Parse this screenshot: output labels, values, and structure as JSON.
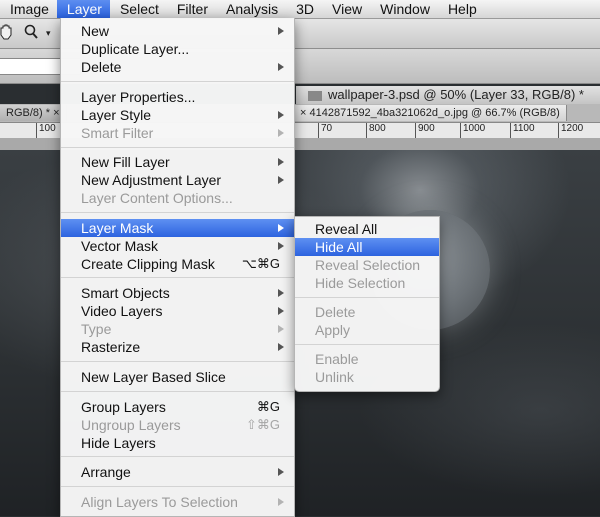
{
  "menubar": {
    "items": [
      {
        "label": "Image"
      },
      {
        "label": "Layer",
        "active": true
      },
      {
        "label": "Select"
      },
      {
        "label": "Filter"
      },
      {
        "label": "Analysis"
      },
      {
        "label": "3D"
      },
      {
        "label": "View"
      },
      {
        "label": "Window"
      },
      {
        "label": "Help"
      }
    ]
  },
  "toolbar": {
    "icons": [
      "hand-icon",
      "zoom-icon"
    ]
  },
  "document": {
    "title": "wallpaper-3.psd @ 50% (Layer 33, RGB/8) *"
  },
  "tabs": [
    {
      "label": "RGB/8) *",
      "close": "×"
    },
    {
      "label": "4142871592_4ba321062d_o.jpg @ 66.7% (RGB/8)",
      "close": "×"
    }
  ],
  "rulers": {
    "left": [
      "100"
    ],
    "right": [
      "70",
      "800",
      "900",
      "1000",
      "1100",
      "1200"
    ]
  },
  "layer_menu": {
    "items": [
      {
        "label": "New",
        "submenu": true
      },
      {
        "label": "Duplicate Layer..."
      },
      {
        "label": "Delete",
        "submenu": true
      },
      {
        "sep": true
      },
      {
        "label": "Layer Properties..."
      },
      {
        "label": "Layer Style",
        "submenu": true
      },
      {
        "label": "Smart Filter",
        "submenu": true,
        "disabled": true
      },
      {
        "sep": true
      },
      {
        "label": "New Fill Layer",
        "submenu": true
      },
      {
        "label": "New Adjustment Layer",
        "submenu": true
      },
      {
        "label": "Layer Content Options...",
        "disabled": true
      },
      {
        "sep": true
      },
      {
        "label": "Layer Mask",
        "submenu": true,
        "highlighted": true
      },
      {
        "label": "Vector Mask",
        "submenu": true
      },
      {
        "label": "Create Clipping Mask",
        "shortcut": "⌥⌘G"
      },
      {
        "sep": true
      },
      {
        "label": "Smart Objects",
        "submenu": true
      },
      {
        "label": "Video Layers",
        "submenu": true
      },
      {
        "label": "Type",
        "submenu": true,
        "disabled": true
      },
      {
        "label": "Rasterize",
        "submenu": true
      },
      {
        "sep": true
      },
      {
        "label": "New Layer Based Slice"
      },
      {
        "sep": true
      },
      {
        "label": "Group Layers",
        "shortcut": "⌘G"
      },
      {
        "label": "Ungroup Layers",
        "shortcut": "⇧⌘G",
        "disabled": true
      },
      {
        "label": "Hide Layers"
      },
      {
        "sep": true
      },
      {
        "label": "Arrange",
        "submenu": true
      },
      {
        "sep": true
      },
      {
        "label": "Align Layers To Selection",
        "submenu": true,
        "disabled": true
      }
    ]
  },
  "mask_menu": {
    "items": [
      {
        "label": "Reveal All"
      },
      {
        "label": "Hide All",
        "highlighted": true
      },
      {
        "label": "Reveal Selection",
        "disabled": true
      },
      {
        "label": "Hide Selection",
        "disabled": true
      },
      {
        "sep": true
      },
      {
        "label": "Delete",
        "disabled": true
      },
      {
        "label": "Apply",
        "disabled": true
      },
      {
        "sep": true
      },
      {
        "label": "Enable",
        "disabled": true
      },
      {
        "label": "Unlink",
        "disabled": true
      }
    ]
  },
  "colors": {
    "highlight": "#2d63df",
    "menu_bg": "#f6f6f6",
    "disabled_text": "#9a9a9a"
  }
}
